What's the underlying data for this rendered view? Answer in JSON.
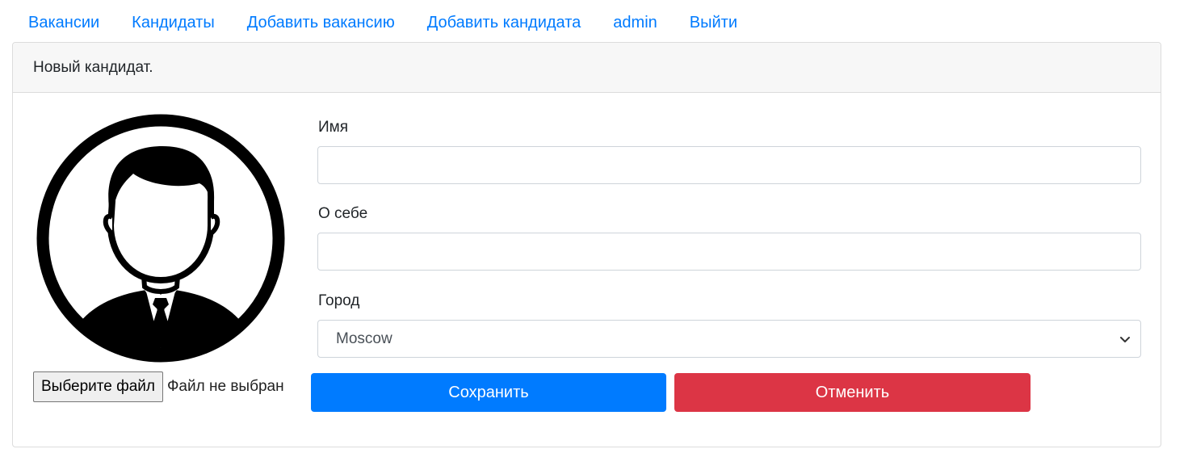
{
  "nav": {
    "items": [
      {
        "label": "Вакансии"
      },
      {
        "label": "Кандидаты"
      },
      {
        "label": "Добавить вакансию"
      },
      {
        "label": "Добавить кандидата"
      },
      {
        "label": "admin"
      },
      {
        "label": "Выйти"
      }
    ]
  },
  "card": {
    "title": "Новый кандидат."
  },
  "file": {
    "button_label": "Выберите файл",
    "status": "Файл не выбран"
  },
  "form": {
    "name_label": "Имя",
    "name_value": "",
    "about_label": "О себе",
    "about_value": "",
    "city_label": "Город",
    "city_value": "Moscow"
  },
  "buttons": {
    "save": "Сохранить",
    "cancel": "Отменить"
  },
  "colors": {
    "link": "#007bff",
    "save": "#007bff",
    "cancel": "#dc3545"
  },
  "icons": {
    "avatar": "user-avatar-icon",
    "dropdown": "chevron-down-icon"
  }
}
